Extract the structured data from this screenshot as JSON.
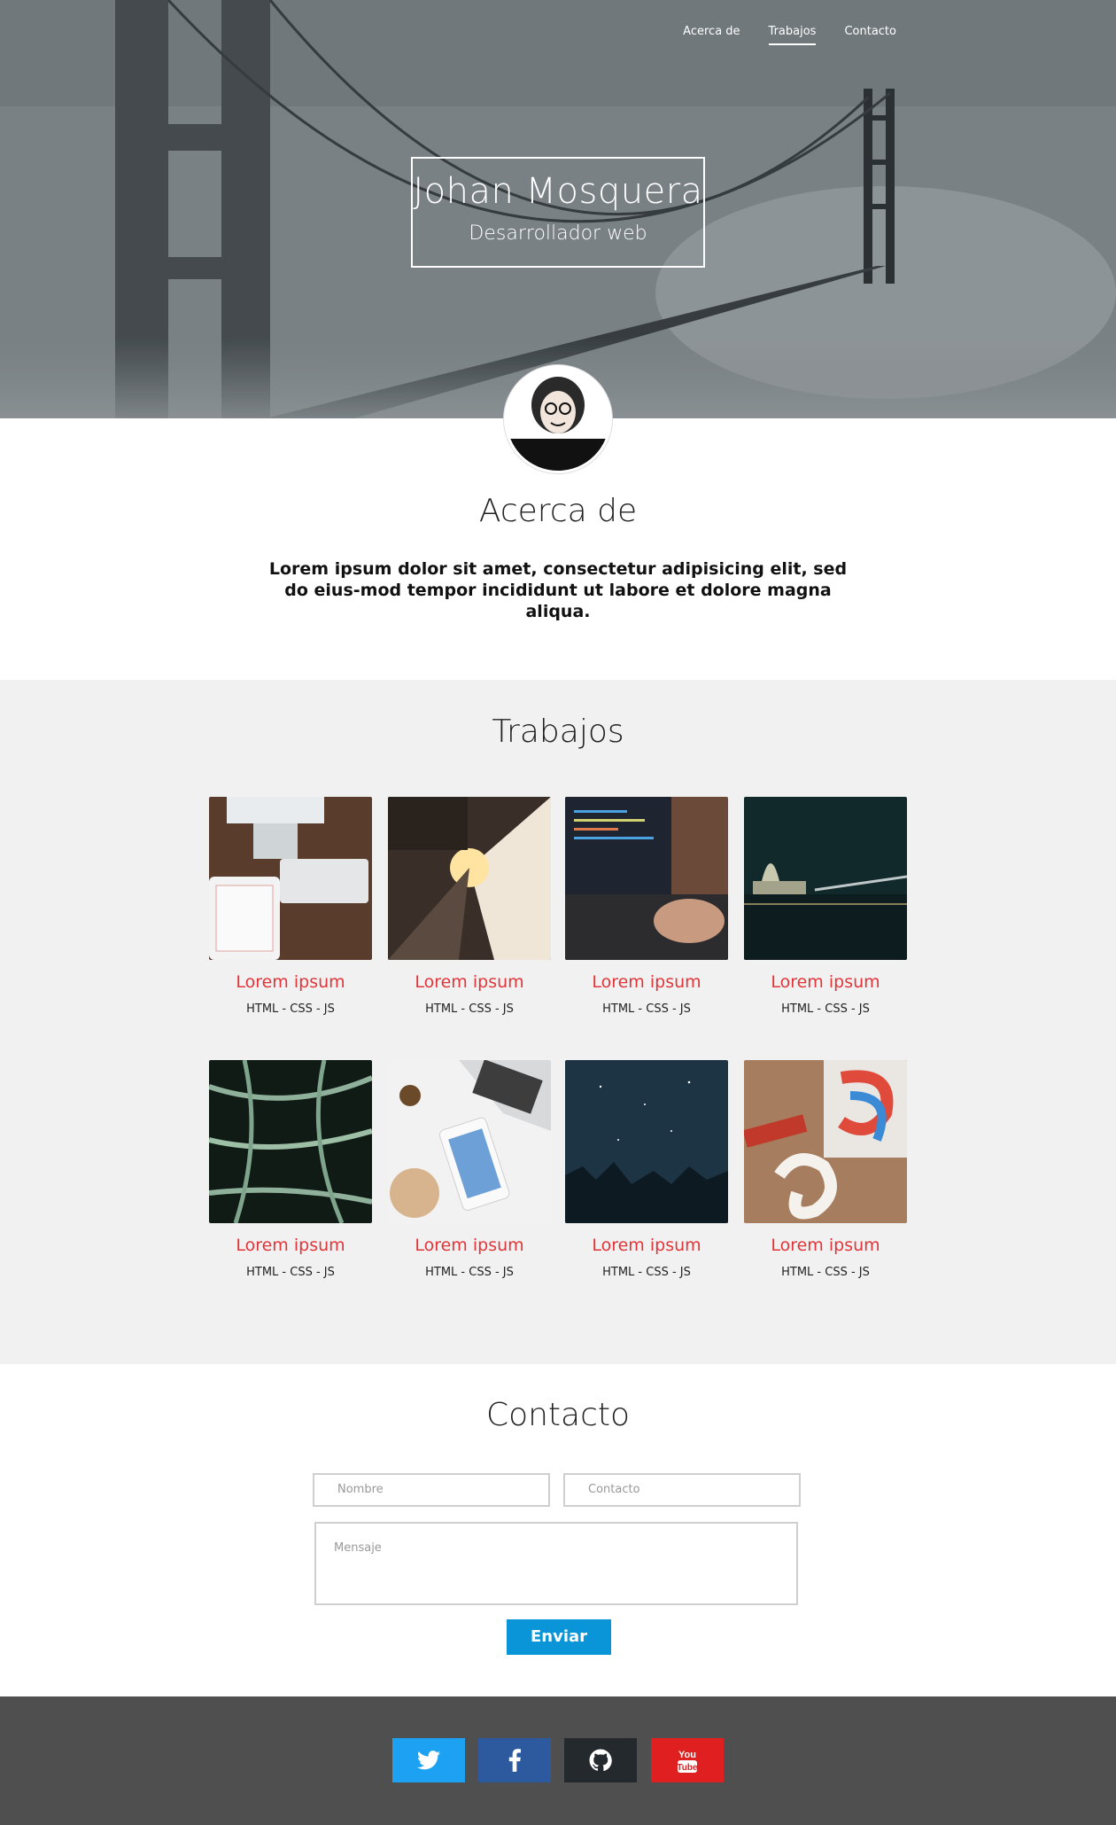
{
  "nav": {
    "items": [
      {
        "label": "Acerca de",
        "active": false
      },
      {
        "label": "Trabajos",
        "active": true
      },
      {
        "label": "Contacto",
        "active": false
      }
    ]
  },
  "hero": {
    "name": "Johan Mosquera",
    "role": "Desarrollador web"
  },
  "about": {
    "title": "Acerca de",
    "text": "Lorem ipsum dolor sit amet, consectetur adipisicing elit, sed do eius-mod tempor incididunt ut labore et dolore magna aliqua."
  },
  "works": {
    "title": "Trabajos",
    "items": [
      {
        "title": "Lorem ipsum",
        "tags": "HTML - CSS - JS",
        "image": "desk-tablet-keyboard"
      },
      {
        "title": "Lorem ipsum",
        "tags": "HTML - CSS - JS",
        "image": "train-station-sunset"
      },
      {
        "title": "Lorem ipsum",
        "tags": "HTML - CSS - JS",
        "image": "laptop-code"
      },
      {
        "title": "Lorem ipsum",
        "tags": "HTML - CSS - JS",
        "image": "city-night-bridge"
      },
      {
        "title": "Lorem ipsum",
        "tags": "HTML - CSS - JS",
        "image": "fern-leaves"
      },
      {
        "title": "Lorem ipsum",
        "tags": "HTML - CSS - JS",
        "image": "phone-laptop-coffee"
      },
      {
        "title": "Lorem ipsum",
        "tags": "HTML - CSS - JS",
        "image": "night-sky-trees"
      },
      {
        "title": "Lorem ipsum",
        "tags": "HTML - CSS - JS",
        "image": "ampersand-design"
      }
    ]
  },
  "contact": {
    "title": "Contacto",
    "name_placeholder": "Nombre",
    "contact_placeholder": "Contacto",
    "message_placeholder": "Mensaje",
    "send_label": "Enviar"
  },
  "footer": {
    "social": [
      {
        "icon": "twitter-icon",
        "color": "#1da1f2"
      },
      {
        "icon": "facebook-icon",
        "color": "#2d5a9e"
      },
      {
        "icon": "github-icon",
        "color": "#24292e"
      },
      {
        "icon": "youtube-icon",
        "color": "#e02020"
      }
    ]
  },
  "colors": {
    "accent": "#e2353a",
    "button": "#0a95d8"
  }
}
